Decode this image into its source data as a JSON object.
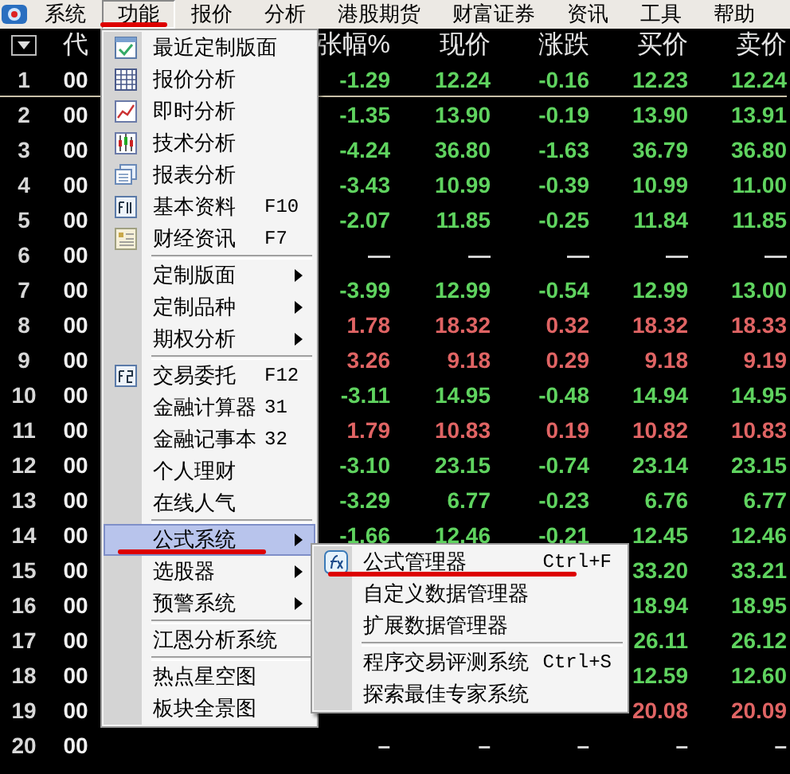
{
  "menubar": [
    {
      "label": "系统",
      "selected": false,
      "underlined": false
    },
    {
      "label": "功能",
      "selected": true,
      "underlined": true
    },
    {
      "label": "报价",
      "selected": false,
      "underlined": false
    },
    {
      "label": "分析",
      "selected": false,
      "underlined": false
    },
    {
      "label": "港股期货",
      "selected": false,
      "underlined": false
    },
    {
      "label": "财富证券",
      "selected": false,
      "underlined": false
    },
    {
      "label": "资讯",
      "selected": false,
      "underlined": false
    },
    {
      "label": "工具",
      "selected": false,
      "underlined": false
    },
    {
      "label": "帮助",
      "selected": false,
      "underlined": false
    }
  ],
  "table": {
    "columns": [
      "代",
      "张幅%",
      "现价",
      "涨跌",
      "买价",
      "卖价"
    ],
    "rows": [
      {
        "index": "1",
        "code": "00",
        "color": "#5fd35f",
        "selected": true,
        "change_pct": "-1.29",
        "price": "12.24",
        "change": "-0.16",
        "bid": "12.23",
        "ask": "12.24"
      },
      {
        "index": "2",
        "code": "00",
        "color": "#5fd35f",
        "selected": false,
        "change_pct": "-1.35",
        "price": "13.90",
        "change": "-0.19",
        "bid": "13.90",
        "ask": "13.91"
      },
      {
        "index": "3",
        "code": "00",
        "color": "#5fd35f",
        "selected": false,
        "change_pct": "-4.24",
        "price": "36.80",
        "change": "-1.63",
        "bid": "36.79",
        "ask": "36.80"
      },
      {
        "index": "4",
        "code": "00",
        "color": "#5fd35f",
        "selected": false,
        "change_pct": "-3.43",
        "price": "10.99",
        "change": "-0.39",
        "bid": "10.99",
        "ask": "11.00"
      },
      {
        "index": "5",
        "code": "00",
        "color": "#5fd35f",
        "selected": false,
        "change_pct": "-2.07",
        "price": "11.85",
        "change": "-0.25",
        "bid": "11.84",
        "ask": "11.85"
      },
      {
        "index": "6",
        "code": "00",
        "color": "#dcdcdc",
        "selected": false,
        "change_pct": "—",
        "price": "—",
        "change": "—",
        "bid": "—",
        "ask": "—"
      },
      {
        "index": "7",
        "code": "00",
        "color": "#5fd35f",
        "selected": false,
        "change_pct": "-3.99",
        "price": "12.99",
        "change": "-0.54",
        "bid": "12.99",
        "ask": "13.00"
      },
      {
        "index": "8",
        "code": "00",
        "color": "#e06464",
        "selected": false,
        "change_pct": "1.78",
        "price": "18.32",
        "change": "0.32",
        "bid": "18.32",
        "ask": "18.33"
      },
      {
        "index": "9",
        "code": "00",
        "color": "#e06464",
        "selected": false,
        "change_pct": "3.26",
        "price": "9.18",
        "change": "0.29",
        "bid": "9.18",
        "ask": "9.19"
      },
      {
        "index": "10",
        "code": "00",
        "color": "#5fd35f",
        "selected": false,
        "change_pct": "-3.11",
        "price": "14.95",
        "change": "-0.48",
        "bid": "14.94",
        "ask": "14.95"
      },
      {
        "index": "11",
        "code": "00",
        "color": "#e06464",
        "selected": false,
        "change_pct": "1.79",
        "price": "10.83",
        "change": "0.19",
        "bid": "10.82",
        "ask": "10.83"
      },
      {
        "index": "12",
        "code": "00",
        "color": "#5fd35f",
        "selected": false,
        "change_pct": "-3.10",
        "price": "23.15",
        "change": "-0.74",
        "bid": "23.14",
        "ask": "23.15"
      },
      {
        "index": "13",
        "code": "00",
        "color": "#5fd35f",
        "selected": false,
        "change_pct": "-3.29",
        "price": "6.77",
        "change": "-0.23",
        "bid": "6.76",
        "ask": "6.77"
      },
      {
        "index": "14",
        "code": "00",
        "color": "#5fd35f",
        "selected": false,
        "change_pct": "-1.66",
        "price": "12.46",
        "change": "-0.21",
        "bid": "12.45",
        "ask": "12.46"
      },
      {
        "index": "15",
        "code": "00",
        "color": "#5fd35f",
        "selected": false,
        "bid": "33.20",
        "ask": "33.21"
      },
      {
        "index": "16",
        "code": "00",
        "color": "#5fd35f",
        "selected": false,
        "bid": "18.94",
        "ask": "18.95"
      },
      {
        "index": "17",
        "code": "00",
        "color": "#5fd35f",
        "selected": false,
        "bid": "26.11",
        "ask": "26.12"
      },
      {
        "index": "18",
        "code": "00",
        "color": "#5fd35f",
        "selected": false,
        "bid": "12.59",
        "ask": "12.60"
      },
      {
        "index": "19",
        "code": "00",
        "color": "#e06464",
        "selected": false,
        "bid": "20.08",
        "ask": "20.09"
      },
      {
        "index": "20",
        "code": "00",
        "color": "#dcdcdc",
        "selected": false,
        "change_pct": "–",
        "price": "–",
        "change": "–",
        "bid": "–",
        "ask": "–"
      }
    ]
  },
  "menu": [
    {
      "kind": "icon",
      "label": "最近定制版面",
      "selected": false,
      "underlined": false
    },
    {
      "kind": "icon",
      "label": "报价分析",
      "selected": false,
      "underlined": false
    },
    {
      "kind": "icon",
      "label": "即时分析",
      "selected": false,
      "underlined": false
    },
    {
      "kind": "icon",
      "label": "技术分析",
      "selected": false,
      "underlined": false
    },
    {
      "kind": "icon",
      "label": "报表分析",
      "selected": false,
      "underlined": false
    },
    {
      "kind": "icon",
      "label": "基本资料",
      "shortcut": "F10",
      "selected": false,
      "underlined": false
    },
    {
      "kind": "icon",
      "label": "财经资讯",
      "shortcut": "F7",
      "selected": false,
      "underlined": false
    },
    {
      "kind": "separator"
    },
    {
      "kind": "submenu",
      "label": "定制版面",
      "selected": false,
      "underlined": false
    },
    {
      "kind": "submenu",
      "label": "定制品种",
      "selected": false,
      "underlined": false
    },
    {
      "kind": "submenu",
      "label": "期权分析",
      "selected": false,
      "underlined": false
    },
    {
      "kind": "separator"
    },
    {
      "kind": "icon",
      "label": "交易委托",
      "shortcut": "F12",
      "selected": false,
      "underlined": false
    },
    {
      "kind": "item",
      "label": "金融计算器",
      "shortcut": "31",
      "selected": false,
      "underlined": false
    },
    {
      "kind": "item",
      "label": "金融记事本",
      "shortcut": "32",
      "selected": false,
      "underlined": false
    },
    {
      "kind": "item",
      "label": "个人理财",
      "selected": false,
      "underlined": false
    },
    {
      "kind": "item",
      "label": "在线人气",
      "selected": false,
      "underlined": false
    },
    {
      "kind": "separator"
    },
    {
      "kind": "submenu",
      "label": "公式系统",
      "selected": true,
      "underlined": true
    },
    {
      "kind": "submenu",
      "label": "选股器",
      "selected": false,
      "underlined": false
    },
    {
      "kind": "submenu",
      "label": "预警系统",
      "selected": false,
      "underlined": false
    },
    {
      "kind": "separator"
    },
    {
      "kind": "item",
      "label": "江恩分析系统",
      "selected": false,
      "underlined": false
    },
    {
      "kind": "separator"
    },
    {
      "kind": "item",
      "label": "热点星空图",
      "selected": false,
      "underlined": false
    },
    {
      "kind": "item",
      "label": "板块全景图",
      "selected": false,
      "underlined": false
    }
  ],
  "submenu": [
    {
      "kind": "icon",
      "label": "公式管理器",
      "shortcut": "Ctrl+F",
      "underlined": true
    },
    {
      "kind": "item",
      "label": "自定义数据管理器",
      "underlined": false
    },
    {
      "kind": "item",
      "label": "扩展数据管理器",
      "underlined": false
    },
    {
      "kind": "separator"
    },
    {
      "kind": "item",
      "label": "程序交易评测系统",
      "shortcut": "Ctrl+S",
      "underlined": false
    },
    {
      "kind": "item",
      "label": "探索最佳专家系统",
      "underlined": false
    }
  ]
}
